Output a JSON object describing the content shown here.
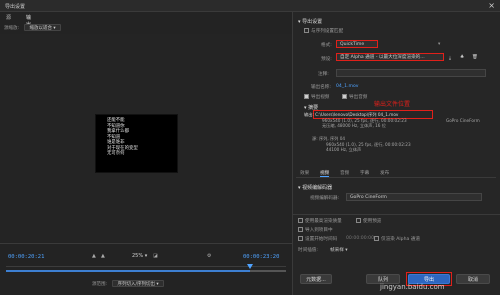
{
  "window": {
    "title": "导出设置",
    "close": "×"
  },
  "left": {
    "tabs": [
      {
        "label": "源"
      },
      {
        "label": "输出"
      }
    ],
    "source_scaling_label": "源缩放:",
    "source_scaling_value": "缩放以适合",
    "subtitles": "还能不能\n不知道你\n我拿什么都\n不知道\n谁是谁非\n对于现在的变型\n无可奈何",
    "timecode_in": "00:00:20:21",
    "timecode_out": "00:00:23:20",
    "zoom": "25%",
    "source_range_label": "源范围:",
    "source_range_value": "序列切入/序列切出"
  },
  "right": {
    "export_settings_header": "导出设置",
    "match_sequence_label": "与序列设置匹配",
    "format_label": "格式:",
    "format_value": "QuickTime",
    "preset_label": "预设:",
    "preset_value": "自定 Alpha 通道 - 以最大位深度渲染的...",
    "comments_label": "注释:",
    "output_name_label": "输出名称:",
    "output_name_value": "04_1.mov",
    "export_video_label": "导出视频",
    "export_audio_label": "导出音频",
    "summary_header": "摘要",
    "annotation": "输出文件位置",
    "output_label": "输出:",
    "output_path": "C:\\Users\\lenovo\\Desktop\\序列 04_1.mov",
    "output_detail1": "960x540 (1.0), 25 fps, 逐行, 00:00:02:23",
    "output_detail2": "无压缩, 48000 Hz, 立体声, 16 位",
    "output_codec": "GoPro CineForm",
    "source_label": "源:",
    "source_name": "序列, 序列 04",
    "source_detail1": "960x540 (1.0), 25 fps, 逐行, 00:00:02:23",
    "source_detail2": "44100 Hz, 立体声",
    "subtabs": [
      {
        "label": "效果"
      },
      {
        "label": "视频"
      },
      {
        "label": "音频"
      },
      {
        "label": "字幕"
      },
      {
        "label": "发布"
      }
    ],
    "video_codec_header": "视频编解码器",
    "video_codec_label": "视频编解码器:",
    "video_codec_value": "GoPro CineForm",
    "opts": {
      "max_render_quality": "使用最高渲染质量",
      "use_previews": "使用预览",
      "import_to_project": "导入到项目中",
      "set_start_tc": "设置开始时间码",
      "start_tc_value": "00:00:00:00",
      "render_alpha": "仅渲染 Alpha 通道",
      "time_interp_label": "时间插值:",
      "time_interp_value": "帧采样"
    },
    "buttons": {
      "queue": "队列",
      "export": "导出",
      "cancel": "取消",
      "metadata": "元数据..."
    }
  },
  "watermark": "jingyan.baidu.com",
  "colors": {
    "accent": "#4fa3ff",
    "annotation": "#e0201a",
    "primary_button": "#2d66c0"
  }
}
